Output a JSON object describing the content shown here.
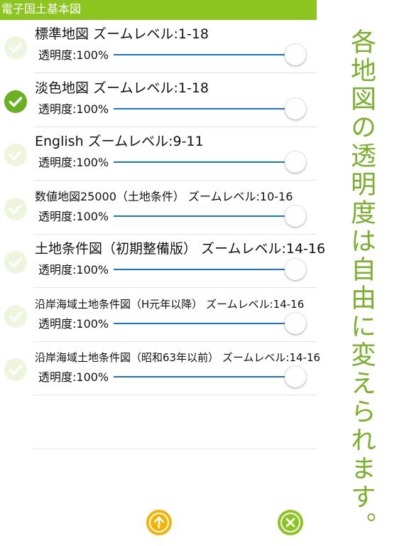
{
  "colors": {
    "header_background": "#8cc51f",
    "check_on": "#6ab023",
    "check_off": "#eef5dd",
    "slider_track": "#1a73d9",
    "up_button": "#f5b301",
    "close_button": "#8cc51f",
    "caption_text": "#7bb02e"
  },
  "header": {
    "title": "電子国土基本図"
  },
  "layers": [
    {
      "name": "標準地図 ズームレベル:1-18",
      "checked": false,
      "opacity_label": "透明度:100%",
      "opacity": 1.0
    },
    {
      "name": "淡色地図 ズームレベル:1-18",
      "checked": true,
      "opacity_label": "透明度:100%",
      "opacity": 1.0
    },
    {
      "name": "English ズームレベル:9-11",
      "checked": false,
      "opacity_label": "透明度:100%",
      "opacity": 1.0
    },
    {
      "name": "数値地図25000（土地条件） ズームレベル:10-16",
      "checked": false,
      "opacity_label": "透明度:100%",
      "opacity": 1.0
    },
    {
      "name": "土地条件図（初期整備版） ズームレベル:14-16",
      "checked": false,
      "opacity_label": "透明度:100%",
      "opacity": 1.0
    },
    {
      "name": "沿岸海域土地条件図（H元年以降） ズームレベル:14-16",
      "checked": false,
      "opacity_label": "透明度:100%",
      "opacity": 1.0
    },
    {
      "name": "沿岸海域土地条件図（昭和63年以前） ズームレベル:14-16",
      "checked": false,
      "opacity_label": "透明度:100%",
      "opacity": 1.0
    }
  ],
  "buttons": {
    "up_icon": "arrow-up-icon",
    "close_icon": "close-icon"
  },
  "caption": "各地図の透明度は自由に変えられます。"
}
